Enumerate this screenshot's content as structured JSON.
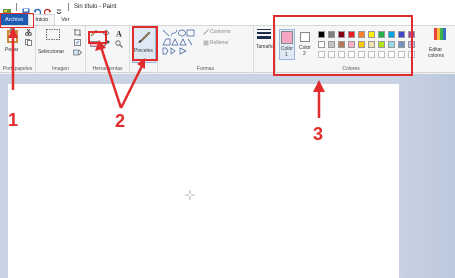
{
  "titlebar": {
    "title": "Sin título - Paint"
  },
  "tabs": [
    {
      "label": "Archivo"
    },
    {
      "label": "Inicio"
    },
    {
      "label": "Ver"
    }
  ],
  "ribbon": {
    "clipboard": {
      "paste_label": "Pegar",
      "group_label": "Portapapeles"
    },
    "image": {
      "select_label": "Seleccionar",
      "group_label": "Imagen"
    },
    "tools": {
      "group_label": "Herramientas"
    },
    "brushes": {
      "label": "Pinceles"
    },
    "shapes": {
      "contour_label": "Contorno",
      "fill_label": "Rellenar",
      "group_label": "Formas"
    },
    "size": {
      "label": "Tamaño"
    },
    "colors": {
      "color1_label": "Color",
      "color1_num": "1",
      "color2_label": "Color",
      "color2_num": "2",
      "group_label": "Colores",
      "edit_label_1": "Editar",
      "edit_label_2": "colores",
      "color1_value": "#f4a6c4",
      "color2_value": "#ffffff",
      "palette_row1": [
        "#000000",
        "#7f7f7f",
        "#880015",
        "#ed1c24",
        "#ff7f27",
        "#fff200",
        "#22b14c",
        "#00a2e8",
        "#3f48cc",
        "#a349a4"
      ],
      "palette_row2": [
        "#ffffff",
        "#c3c3c3",
        "#b97a57",
        "#ffaec9",
        "#ffc90e",
        "#efe4b0",
        "#b5e61d",
        "#99d9ea",
        "#7092be",
        "#c8bfe7"
      ]
    }
  },
  "annotations": {
    "n1": "1",
    "n2": "2",
    "n3": "3",
    "color": "#e02c2c"
  }
}
